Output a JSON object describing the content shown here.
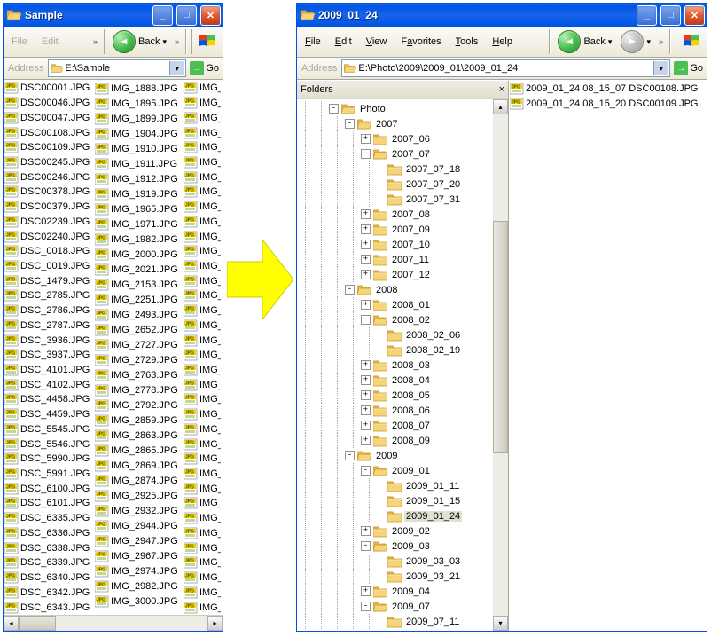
{
  "left": {
    "title": "Sample",
    "menu": [
      "File",
      "Edit"
    ],
    "back": "Back",
    "address_label": "Address",
    "address": "E:\\Sample",
    "go": "Go",
    "col1": [
      "DSC00001.JPG",
      "DSC00046.JPG",
      "DSC00047.JPG",
      "DSC00108.JPG",
      "DSC00109.JPG",
      "DSC00245.JPG",
      "DSC00246.JPG",
      "DSC00378.JPG",
      "DSC00379.JPG",
      "DSC02239.JPG",
      "DSC02240.JPG",
      "DSC_0018.JPG",
      "DSC_0019.JPG",
      "DSC_1479.JPG",
      "DSC_2785.JPG",
      "DSC_2786.JPG",
      "DSC_2787.JPG",
      "DSC_3936.JPG",
      "DSC_3937.JPG",
      "DSC_4101.JPG",
      "DSC_4102.JPG",
      "DSC_4458.JPG",
      "DSC_4459.JPG",
      "DSC_5545.JPG",
      "DSC_5546.JPG",
      "DSC_5990.JPG",
      "DSC_5991.JPG",
      "DSC_6100.JPG",
      "DSC_6101.JPG",
      "DSC_6335.JPG",
      "DSC_6336.JPG",
      "DSC_6338.JPG",
      "DSC_6339.JPG",
      "DSC_6340.JPG",
      "DSC_6342.JPG",
      "DSC_6343.JPG"
    ],
    "col2": [
      "IMG_1888.JPG",
      "IMG_1895.JPG",
      "IMG_1899.JPG",
      "IMG_1904.JPG",
      "IMG_1910.JPG",
      "IMG_1911.JPG",
      "IMG_1912.JPG",
      "IMG_1919.JPG",
      "IMG_1965.JPG",
      "IMG_1971.JPG",
      "IMG_1982.JPG",
      "IMG_2000.JPG",
      "IMG_2021.JPG",
      "IMG_2153.JPG",
      "IMG_2251.JPG",
      "IMG_2493.JPG",
      "IMG_2652.JPG",
      "IMG_2727.JPG",
      "IMG_2729.JPG",
      "IMG_2763.JPG",
      "IMG_2778.JPG",
      "IMG_2792.JPG",
      "IMG_2859.JPG",
      "IMG_2863.JPG",
      "IMG_2865.JPG",
      "IMG_2869.JPG",
      "IMG_2874.JPG",
      "IMG_2925.JPG",
      "IMG_2932.JPG",
      "IMG_2944.JPG",
      "IMG_2947.JPG",
      "IMG_2967.JPG",
      "IMG_2974.JPG",
      "IMG_2982.JPG",
      "IMG_3000.JPG"
    ],
    "col3_prefix": "IMG_"
  },
  "right": {
    "title": "2009_01_24",
    "menu": [
      "File",
      "Edit",
      "View",
      "Favorites",
      "Tools",
      "Help"
    ],
    "back": "Back",
    "address_label": "Address",
    "address": "E:\\Photo\\2009\\2009_01\\2009_01_24",
    "go": "Go",
    "folders_label": "Folders",
    "files": [
      "2009_01_24 08_15_07 DSC00108.JPG",
      "2009_01_24 08_15_20 DSC00109.JPG"
    ],
    "tree": [
      {
        "d": 2,
        "e": "-",
        "l": "Photo"
      },
      {
        "d": 3,
        "e": "-",
        "l": "2007"
      },
      {
        "d": 4,
        "e": "+",
        "l": "2007_06"
      },
      {
        "d": 4,
        "e": "-",
        "l": "2007_07"
      },
      {
        "d": 5,
        "e": " ",
        "l": "2007_07_18"
      },
      {
        "d": 5,
        "e": " ",
        "l": "2007_07_20"
      },
      {
        "d": 5,
        "e": " ",
        "l": "2007_07_31"
      },
      {
        "d": 4,
        "e": "+",
        "l": "2007_08"
      },
      {
        "d": 4,
        "e": "+",
        "l": "2007_09"
      },
      {
        "d": 4,
        "e": "+",
        "l": "2007_10"
      },
      {
        "d": 4,
        "e": "+",
        "l": "2007_11"
      },
      {
        "d": 4,
        "e": "+",
        "l": "2007_12"
      },
      {
        "d": 3,
        "e": "-",
        "l": "2008"
      },
      {
        "d": 4,
        "e": "+",
        "l": "2008_01"
      },
      {
        "d": 4,
        "e": "-",
        "l": "2008_02"
      },
      {
        "d": 5,
        "e": " ",
        "l": "2008_02_06"
      },
      {
        "d": 5,
        "e": " ",
        "l": "2008_02_19"
      },
      {
        "d": 4,
        "e": "+",
        "l": "2008_03"
      },
      {
        "d": 4,
        "e": "+",
        "l": "2008_04"
      },
      {
        "d": 4,
        "e": "+",
        "l": "2008_05"
      },
      {
        "d": 4,
        "e": "+",
        "l": "2008_06"
      },
      {
        "d": 4,
        "e": "+",
        "l": "2008_07"
      },
      {
        "d": 4,
        "e": "+",
        "l": "2008_09"
      },
      {
        "d": 3,
        "e": "-",
        "l": "2009"
      },
      {
        "d": 4,
        "e": "-",
        "l": "2009_01"
      },
      {
        "d": 5,
        "e": " ",
        "l": "2009_01_11"
      },
      {
        "d": 5,
        "e": " ",
        "l": "2009_01_15"
      },
      {
        "d": 5,
        "e": " ",
        "l": "2009_01_24",
        "sel": true
      },
      {
        "d": 4,
        "e": "+",
        "l": "2009_02"
      },
      {
        "d": 4,
        "e": "-",
        "l": "2009_03"
      },
      {
        "d": 5,
        "e": " ",
        "l": "2009_03_03"
      },
      {
        "d": 5,
        "e": " ",
        "l": "2009_03_21"
      },
      {
        "d": 4,
        "e": "+",
        "l": "2009_04"
      },
      {
        "d": 4,
        "e": "-",
        "l": "2009_07"
      },
      {
        "d": 5,
        "e": " ",
        "l": "2009_07_11"
      }
    ]
  }
}
